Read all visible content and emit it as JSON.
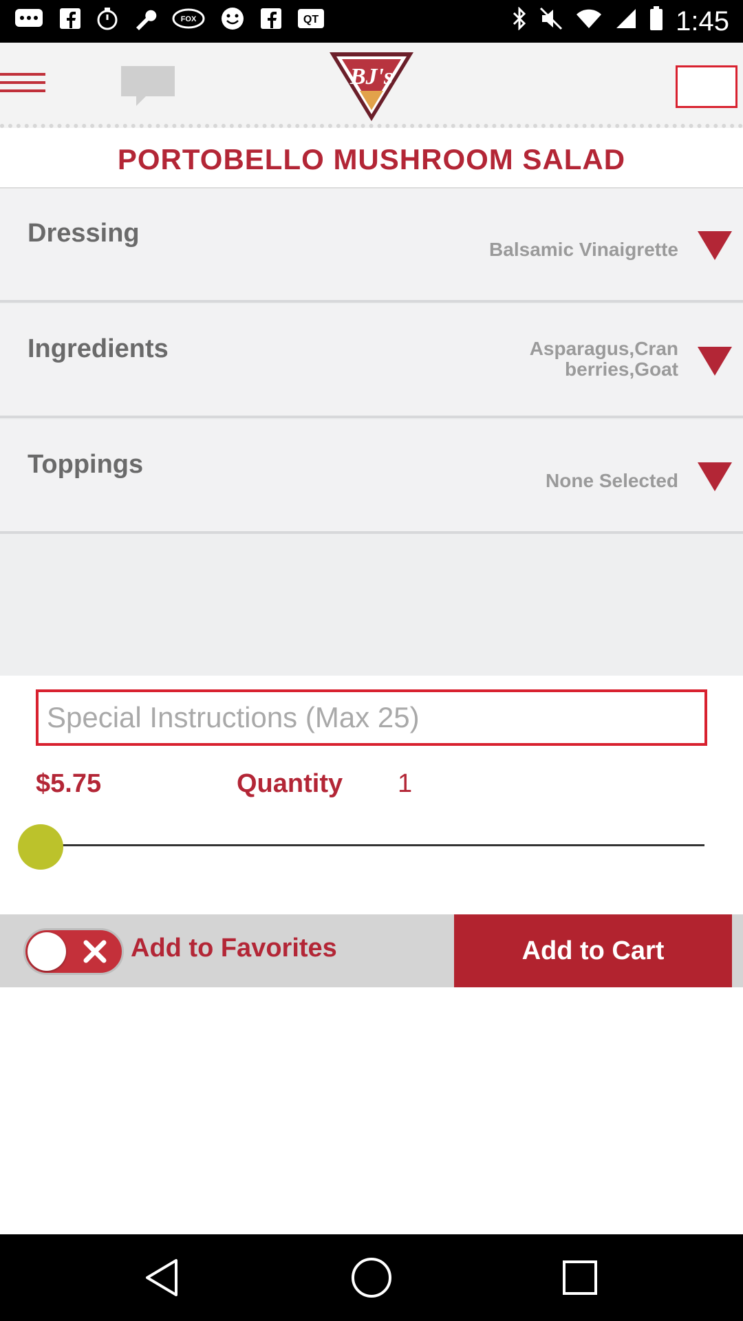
{
  "status_bar": {
    "time": "1:45",
    "icons": [
      "messenger-icon",
      "facebook-icon",
      "stopwatch-icon",
      "wrench-icon",
      "fox-sports-icon",
      "smiley-icon",
      "facebook-icon",
      "qt-icon",
      "bluetooth-icon",
      "mute-icon",
      "wifi-icon",
      "cell-signal-icon",
      "battery-icon"
    ],
    "fox_label": "FOX",
    "qt_label": "QT"
  },
  "header": {
    "logo_text": "BJ's",
    "menu_icon": "hamburger-icon",
    "chat_icon": "chat-icon",
    "cart_icon": "cart-box"
  },
  "item": {
    "title": "PORTOBELLO MUSHROOM SALAD"
  },
  "options": [
    {
      "label": "Dressing",
      "value": "Balsamic Vinaigrette"
    },
    {
      "label": "Ingredients",
      "value": "Asparagus,Cranberries,Goat"
    },
    {
      "label": "Toppings",
      "value": "None Selected"
    }
  ],
  "special_instructions": {
    "placeholder": "Special Instructions (Max 25)",
    "value": ""
  },
  "order": {
    "price": "$5.75",
    "quantity_label": "Quantity",
    "quantity_value": "1",
    "slider_level": 0
  },
  "actions": {
    "favorites_label": "Add to Favorites",
    "favorites_on": false,
    "cart_label": "Add to Cart"
  },
  "colors": {
    "brand_red": "#b32636",
    "accent_red": "#d8212f",
    "slider_thumb": "#bcc22b"
  }
}
